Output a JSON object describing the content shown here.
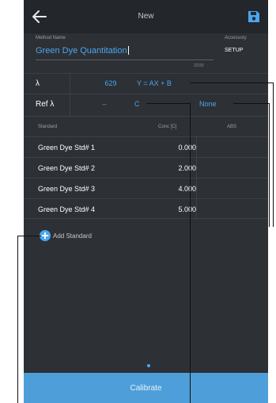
{
  "header": {
    "title": "New",
    "back_icon": "back-arrow-icon",
    "save_icon": "save-floppy-icon"
  },
  "method": {
    "label": "Method Name",
    "value": "Green Dye Quantitation",
    "char_count": "22/33"
  },
  "accessory": {
    "label": "Accessory",
    "value": "SETUP"
  },
  "wavelength": {
    "label": "λ",
    "value": "629",
    "equation": "Y = AX + B"
  },
  "reference": {
    "label": "Ref λ",
    "value": "–",
    "column_var": "C",
    "second_var": "None"
  },
  "table": {
    "headers": {
      "standard": "Standard",
      "conc": "Conc [C]",
      "abs": "ABS"
    },
    "rows": [
      {
        "name": "Green Dye Std# 1",
        "conc": "0.000",
        "abs": ""
      },
      {
        "name": "Green Dye Std# 2",
        "conc": "2.000",
        "abs": ""
      },
      {
        "name": "Green Dye Std# 3",
        "conc": "4.000",
        "abs": ""
      },
      {
        "name": "Green Dye Std# 4",
        "conc": "5.000",
        "abs": ""
      }
    ]
  },
  "add_standard": {
    "label": "Add Standard",
    "icon": "plus-circle-icon"
  },
  "calibrate": {
    "label": "Calibrate"
  },
  "colors": {
    "background": "#2d3035",
    "topbar": "#23262b",
    "accent": "#4aa6ee",
    "button": "#4e9fd9"
  }
}
